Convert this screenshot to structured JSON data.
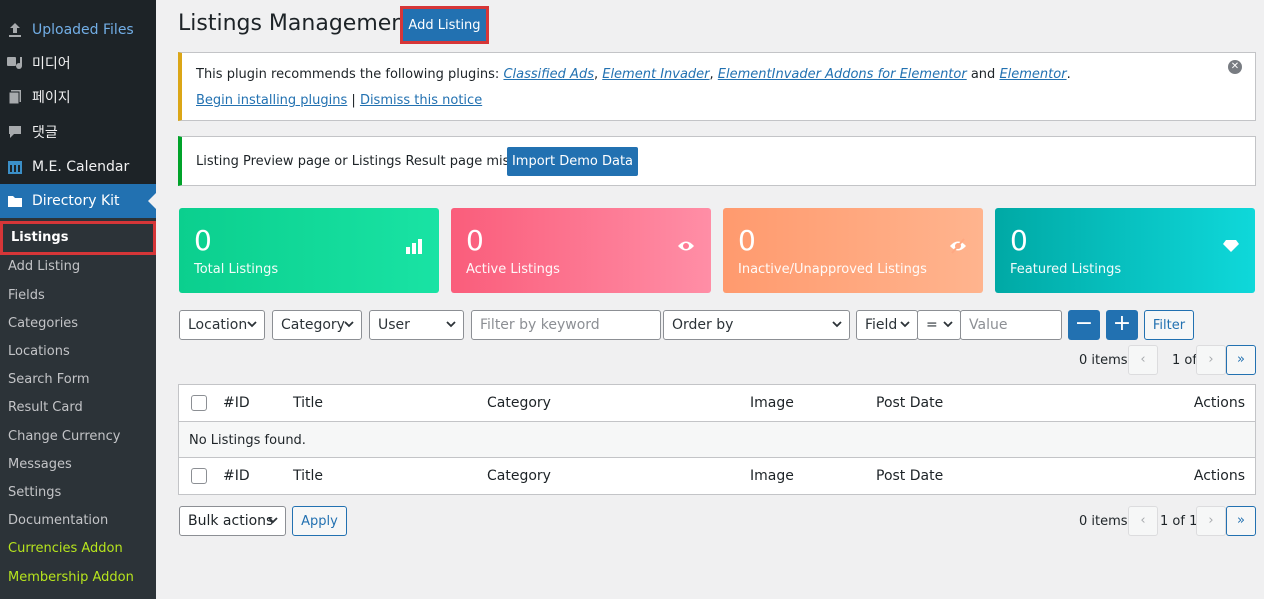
{
  "sidebar": {
    "menu": [
      {
        "label": "Uploaded Files",
        "icon": "upload-icon"
      },
      {
        "label": "미디어",
        "icon": "media-icon"
      },
      {
        "label": "페이지",
        "icon": "page-icon"
      },
      {
        "label": "댓글",
        "icon": "comment-icon"
      },
      {
        "label": "M.E. Calendar",
        "icon": "calendar-icon"
      },
      {
        "label": "Directory Kit",
        "icon": "folder-icon"
      }
    ],
    "submenu": [
      "Listings",
      "Add Listing",
      "Fields",
      "Categories",
      "Locations",
      "Search Form",
      "Result Card",
      "Change Currency",
      "Messages",
      "Settings",
      "Documentation",
      "Currencies Addon",
      "Membership Addon"
    ]
  },
  "header": {
    "title": "Listings Management",
    "add_button": "Add Listing"
  },
  "notice1": {
    "intro": "This plugin recommends the following plugins: ",
    "plugins": [
      "Classified Ads",
      "Element Invader",
      "ElementInvader Addons for Elementor",
      "Elementor"
    ],
    "sep": ", ",
    "and": " and ",
    "end": ".",
    "begin_link": "Begin installing plugins",
    "pipe": " | ",
    "dismiss_link": "Dismiss this notice",
    "close_icon": "close-icon"
  },
  "notice2": {
    "text": "Listing Preview page or Listings Result page missing",
    "button": "Import Demo Data"
  },
  "stats": [
    {
      "value": "0",
      "label": "Total Listings",
      "icon": "bar-chart-icon"
    },
    {
      "value": "0",
      "label": "Active Listings",
      "icon": "eye-icon"
    },
    {
      "value": "0",
      "label": "Inactive/Unapproved Listings",
      "icon": "eye-slash-icon"
    },
    {
      "value": "0",
      "label": "Featured Listings",
      "icon": "diamond-icon"
    }
  ],
  "filters": {
    "location": "Location",
    "category": "Category",
    "user": "User",
    "keyword_placeholder": "Filter by keyword",
    "order_by": "Order by",
    "field": "Field",
    "operator": "=",
    "value_placeholder": "Value",
    "minus": "−",
    "plus": "+",
    "filter_button": "Filter"
  },
  "pagination": {
    "items": "0 items",
    "prev": "‹",
    "page_info": "1 of 1",
    "next": "›",
    "last": "»"
  },
  "table": {
    "columns": [
      "#ID",
      "Title",
      "Category",
      "Image",
      "Post Date",
      "Actions"
    ],
    "empty_message": "No Listings found."
  },
  "bulk": {
    "select": "Bulk actions",
    "apply": "Apply"
  }
}
